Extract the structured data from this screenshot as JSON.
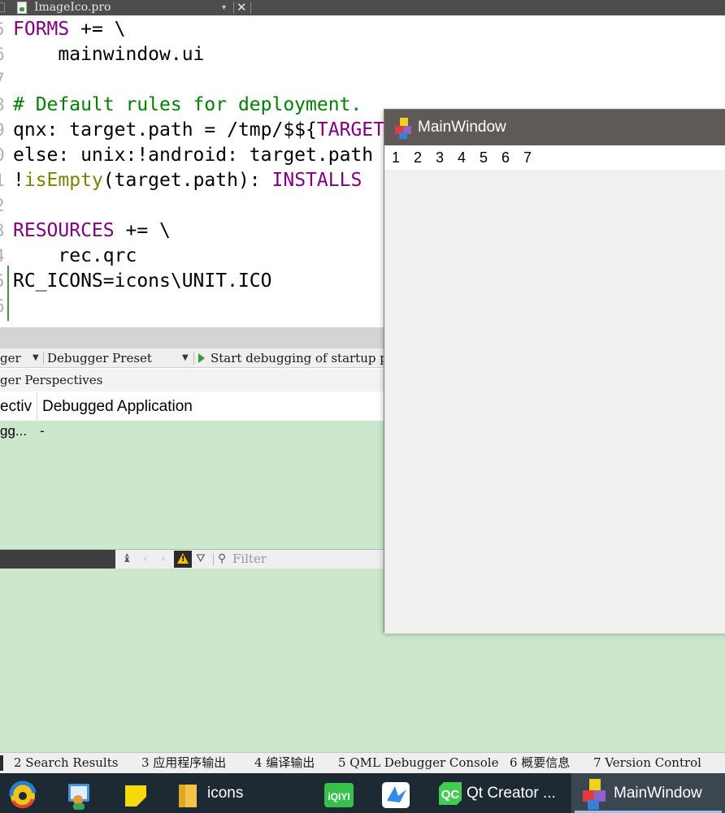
{
  "file_tab": {
    "file_name": "ImageIco.pro",
    "dropdown_glyph": "▾",
    "close_glyph": "✕"
  },
  "editor": {
    "gutter_numbers": [
      "5",
      "6",
      "7",
      "8",
      "9",
      "0",
      "1",
      "2",
      "3",
      "4",
      "5",
      "6"
    ],
    "lines": [
      {
        "parts": [
          {
            "t": "FORMS",
            "c": "kw"
          },
          {
            "t": " += \\",
            "c": ""
          }
        ]
      },
      {
        "parts": [
          {
            "t": "    mainwindow.ui",
            "c": ""
          }
        ]
      },
      {
        "parts": []
      },
      {
        "parts": [
          {
            "t": "# Default rules for deployment.",
            "c": "cm"
          }
        ]
      },
      {
        "parts": [
          {
            "t": "qnx: target.path = /tmp/$${",
            "c": ""
          },
          {
            "t": "TARGET",
            "c": "kw"
          }
        ]
      },
      {
        "parts": [
          {
            "t": "else: unix:!android: target.path",
            "c": ""
          }
        ]
      },
      {
        "parts": [
          {
            "t": "!",
            "c": ""
          },
          {
            "t": "isEmpty",
            "c": "fn"
          },
          {
            "t": "(target.path): ",
            "c": ""
          },
          {
            "t": "INSTALLS",
            "c": "kw"
          }
        ]
      },
      {
        "parts": []
      },
      {
        "parts": [
          {
            "t": "RESOURCES",
            "c": "kw"
          },
          {
            "t": " += \\",
            "c": ""
          }
        ]
      },
      {
        "parts": [
          {
            "t": "    rec.qrc",
            "c": ""
          }
        ]
      },
      {
        "parts": [
          {
            "t": "RC_ICONS=icons\\UNIT.ICO",
            "c": ""
          }
        ]
      },
      {
        "parts": []
      }
    ]
  },
  "debugger_toolbar": {
    "item1": "ger",
    "preset_label": "Debugger Preset",
    "start_label": "Start debugging of startup project"
  },
  "perspectives": {
    "bar_label": "ger Perspectives",
    "col1_header": "ectiv",
    "col2_header": "Debugged Application",
    "row_col1": "gg...",
    "row_col2": "-"
  },
  "issues_bar": {
    "filter_placeholder": "Filter",
    "prev_glyph": "‹",
    "next_glyph": "›",
    "warning_glyph": "!"
  },
  "output_tabs": [
    "2 Search Results",
    "3 应用程序输出",
    "4 编译输出",
    "5 QML Debugger Console",
    "6 概要信息",
    "7 Version Control"
  ],
  "taskbar": {
    "folder_label": "icons",
    "qt_creator_label": "Qt Creator ...",
    "main_window_label": "MainWindow",
    "iqiyi_text": "iQIYI",
    "qc_badge": "QC"
  },
  "main_window": {
    "title": "MainWindow",
    "menu_items": [
      "1",
      "2",
      "3",
      "4",
      "5",
      "6",
      "7"
    ]
  },
  "colors": {
    "keyword": "#800080",
    "comment": "#008000",
    "function": "#808000",
    "pane_green": "#cbe8cd",
    "taskbar": "#1e2a33"
  }
}
